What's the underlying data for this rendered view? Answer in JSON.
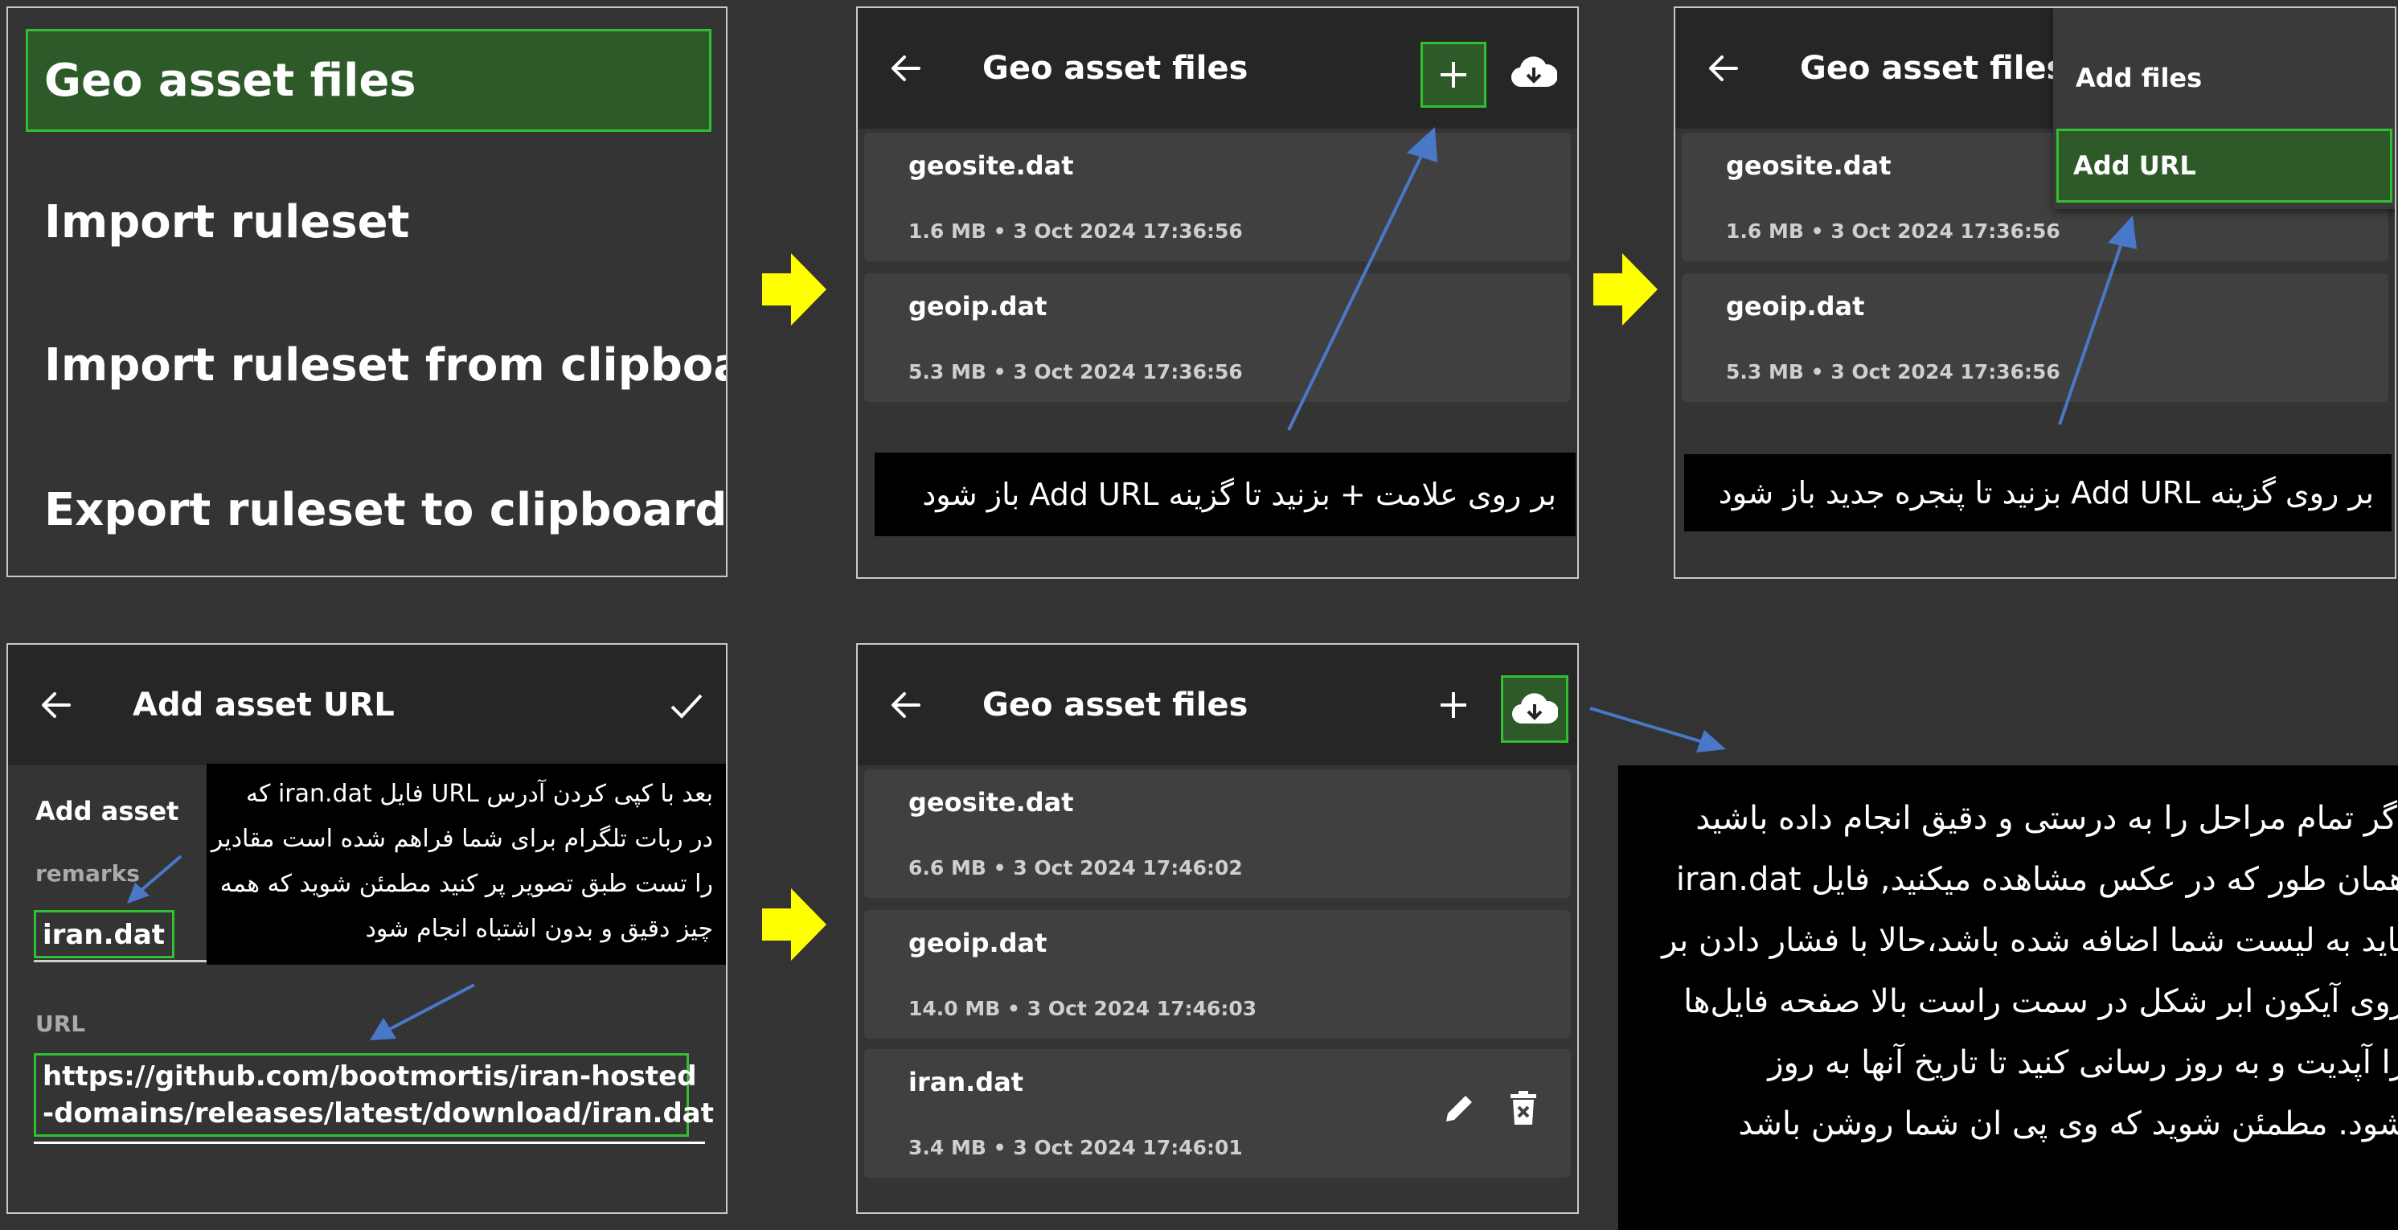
{
  "panel1": {
    "items": [
      "Geo asset files",
      "Import ruleset",
      "Import ruleset from clipboard",
      "Export ruleset to clipboard"
    ]
  },
  "panel2": {
    "title": "Geo asset files",
    "files": [
      {
        "name": "geosite.dat",
        "size": "1.6 MB",
        "date": "3 Oct 2024 17:36:56"
      },
      {
        "name": "geoip.dat",
        "size": "5.3 MB",
        "date": "3 Oct 2024 17:36:56"
      }
    ],
    "caption": "بر روی علامت + بزنید تا گزینه Add URL باز شود"
  },
  "panel3": {
    "title": "Geo asset files",
    "menu": [
      "Add files",
      "Add URL"
    ],
    "files": [
      {
        "name": "geosite.dat",
        "size": "1.6 MB",
        "date": "3 Oct 2024 17:36:56"
      },
      {
        "name": "geoip.dat",
        "size": "5.3 MB",
        "date": "3 Oct 2024 17:36:56"
      }
    ],
    "caption": "بر روی گزینه Add URL بزنید تا پنجره جدید باز شود"
  },
  "panel4": {
    "title": "Add asset URL",
    "label_add_asset": "Add asset",
    "label_remarks": "remarks",
    "remarks_value": "iran.dat",
    "label_url": "URL",
    "url_value_lines": [
      "https://github.com/bootmortis/iran-hosted",
      "-domains/releases/latest/download/iran.dat"
    ],
    "caption_lines": [
      "بعد با کپی کردن آدرس URL فایل iran.dat که",
      "در ربات تلگرام برای شما فراهم شده است مقادیر",
      "را تست طبق تصویر پر کنید مطمئن شوید که همه",
      "چیز دقیق و بدون اشتباه انجام شود"
    ]
  },
  "panel5": {
    "title": "Geo asset files",
    "files": [
      {
        "name": "geosite.dat",
        "size": "6.6 MB",
        "date": "3 Oct 2024 17:46:02"
      },
      {
        "name": "geoip.dat",
        "size": "14.0 MB",
        "date": "3 Oct 2024 17:46:03"
      },
      {
        "name": "iran.dat",
        "size": "3.4 MB",
        "date": "3 Oct 2024 17:46:01"
      }
    ]
  },
  "final_note_lines": [
    "اگر تمام مراحل را به درستی و دقیق انجام داده باشید",
    "همان طور که در عکس مشاهده میکنید, فایل iran.dat",
    "باید به لیست شما اضافه شده باشد،حالا با فشار دادن بر",
    "روی آیکون ابر شکل در سمت راست بالا صفحه فایل‌ها",
    "را آپدیت و به روز رسانی کنید تا تاریخ آنها به روز",
    "شود. مطمئن شوید که وی پی ان شما روشن باشد"
  ],
  "colors": {
    "background": "#333333",
    "appbar": "#262626",
    "card": "#404040",
    "highlight_border": "#30c030",
    "arrow_yellow": "#ffff00",
    "pointer_blue": "#4a78c8"
  },
  "icons": [
    "back-arrow-icon",
    "plus-icon",
    "cloud-download-icon",
    "check-icon",
    "pencil-icon",
    "delete-icon"
  ]
}
